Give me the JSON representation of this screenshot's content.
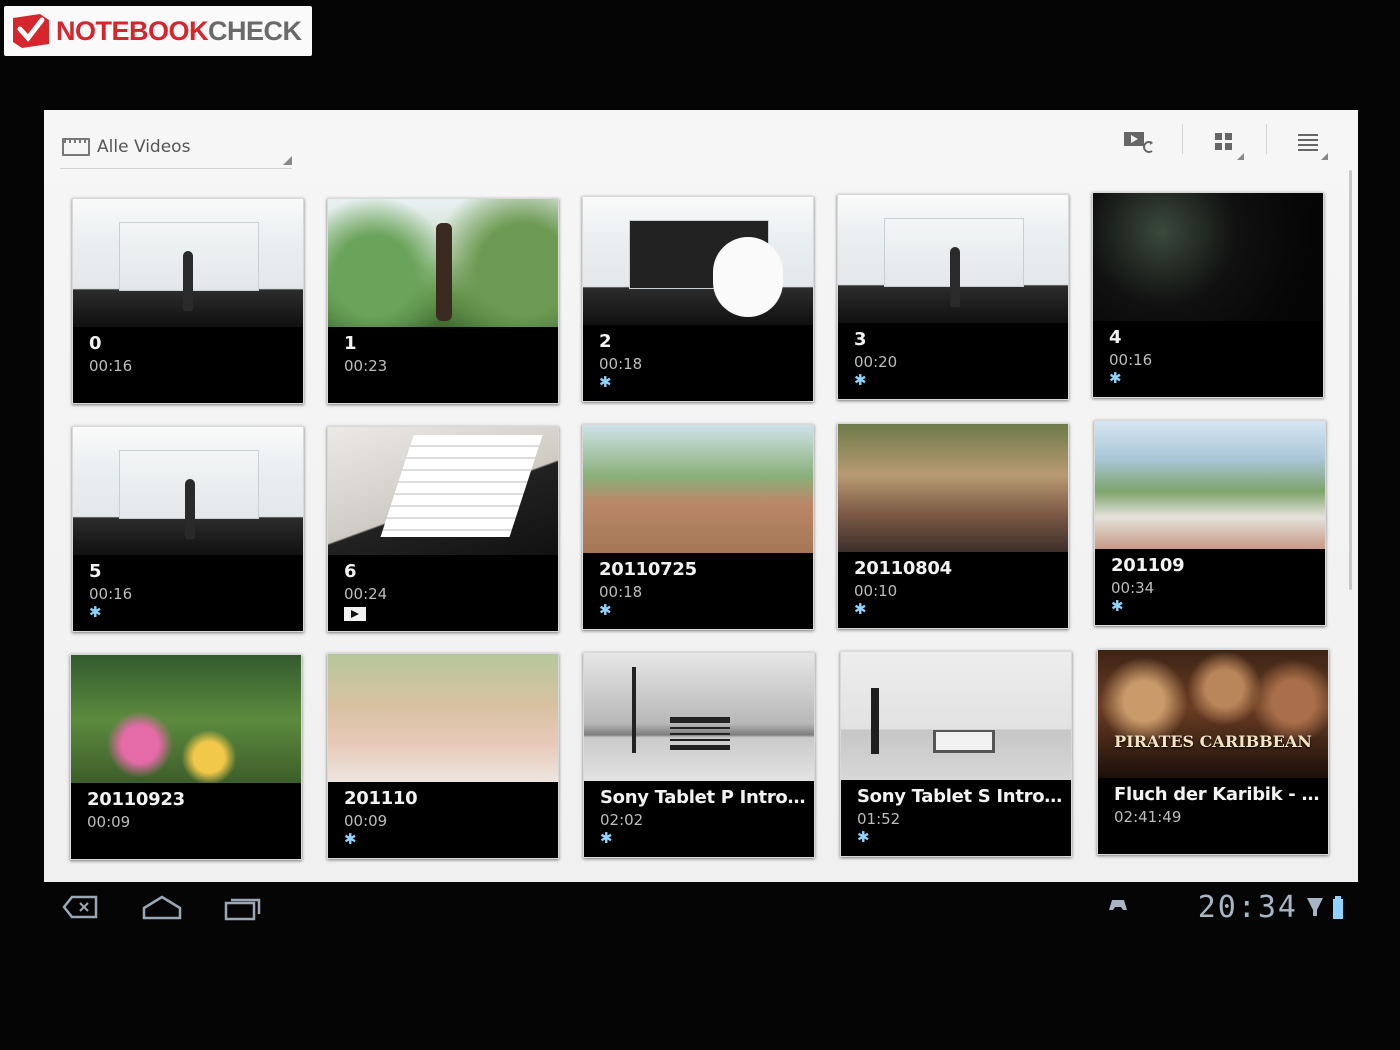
{
  "watermark": {
    "part1": "NOTEBOOK",
    "part2": "CHECK"
  },
  "header": {
    "album_label": "Alle Videos",
    "icons": [
      "slideshow-icon",
      "grid-view-icon",
      "list-view-icon"
    ]
  },
  "videos": [
    {
      "title": "0",
      "duration": "00:16",
      "badge": ""
    },
    {
      "title": "1",
      "duration": "00:23",
      "badge": ""
    },
    {
      "title": "2",
      "duration": "00:18",
      "badge": "gear"
    },
    {
      "title": "3",
      "duration": "00:20",
      "badge": "gear"
    },
    {
      "title": "4",
      "duration": "00:16",
      "badge": "gear"
    },
    {
      "title": "5",
      "duration": "00:16",
      "badge": "gear"
    },
    {
      "title": "6",
      "duration": "00:24",
      "badge": "play"
    },
    {
      "title": "20110725",
      "duration": "00:18",
      "badge": "gear"
    },
    {
      "title": "20110804",
      "duration": "00:10",
      "badge": "gear"
    },
    {
      "title": "201109",
      "duration": "00:34",
      "badge": "gear"
    },
    {
      "title": "20110923",
      "duration": "00:09",
      "badge": ""
    },
    {
      "title": "201110",
      "duration": "00:09",
      "badge": "gear"
    },
    {
      "title": "Sony Tablet P Introdu...",
      "duration": "02:02",
      "badge": "gear"
    },
    {
      "title": "Sony Tablet S Introdu...",
      "duration": "01:52",
      "badge": "gear"
    },
    {
      "title": "Fluch der Karibik - A...",
      "duration": "02:41:49",
      "badge": "",
      "poster_text": "PIRATES CARIBBEAN"
    }
  ],
  "badges": {
    "gear": "✱"
  },
  "status_bar": {
    "time": "20:34",
    "icons": [
      "back-icon",
      "home-icon",
      "recent-apps-icon",
      "gamepad-icon",
      "signal-icon",
      "battery-icon"
    ]
  }
}
